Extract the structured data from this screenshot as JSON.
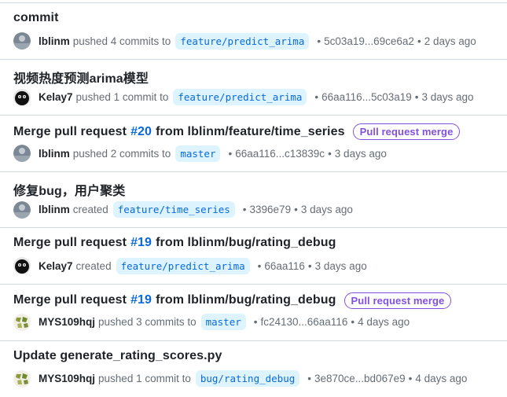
{
  "colors": {
    "link": "#0969da",
    "branch_bg": "#ddf4ff",
    "badge": "#8250df",
    "muted": "#656d76",
    "text": "#1f2328"
  },
  "items": [
    {
      "title": "commit",
      "user": "lblinm",
      "avatar": "avatar-gray",
      "action": "pushed 4 commits to",
      "branch": "feature/predict_arima",
      "hash": "5c03a19...69ce6a2",
      "time": "2 days ago"
    },
    {
      "title": "视频热度预测arima模型",
      "user": "Kelay7",
      "avatar": "avatar-black-cat",
      "action": "pushed 1 commit to",
      "branch": "feature/predict_arima",
      "hash": "66aa116...5c03a19",
      "time": "3 days ago"
    },
    {
      "title_prefix": "Merge pull request",
      "pr_number": "#20",
      "title_suffix": "from lblinm/feature/time_series",
      "badge": "Pull request merge",
      "user": "lblinm",
      "avatar": "avatar-gray",
      "action": "pushed 2 commits to",
      "branch": "master",
      "hash": "66aa116...c13839c",
      "time": "3 days ago"
    },
    {
      "title": "修复bug，用户聚类",
      "user": "lblinm",
      "avatar": "avatar-gray",
      "action": "created",
      "branch": "feature/time_series",
      "hash": "3396e79",
      "time": "3 days ago"
    },
    {
      "title_prefix": "Merge pull request",
      "pr_number": "#19",
      "title_suffix": "from lblinm/bug/rating_debug",
      "user": "Kelay7",
      "avatar": "avatar-black-cat",
      "action": "created",
      "branch": "feature/predict_arima",
      "hash": "66aa116",
      "time": "3 days ago"
    },
    {
      "title_prefix": "Merge pull request",
      "pr_number": "#19",
      "title_suffix": "from lblinm/bug/rating_debug",
      "badge": "Pull request merge",
      "user": "MYS109hqj",
      "avatar": "avatar-identicon",
      "action": "pushed 3 commits to",
      "branch": "master",
      "hash": "fc24130...66aa116",
      "time": "4 days ago"
    },
    {
      "title": "Update generate_rating_scores.py",
      "user": "MYS109hqj",
      "avatar": "avatar-identicon",
      "action": "pushed 1 commit to",
      "branch": "bug/rating_debug",
      "hash": "3e870ce...bd067e9",
      "time": "4 days ago"
    }
  ]
}
